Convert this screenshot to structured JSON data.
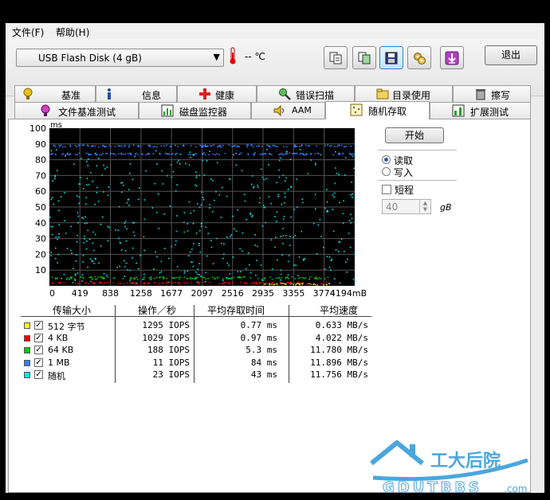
{
  "menu": {
    "file": "文件(F)",
    "help": "帮助(H)"
  },
  "toolbar": {
    "drive": "USB Flash Disk   (4 gB)",
    "temperature": "-- ℃",
    "exit": "退出",
    "icons": [
      "copy-icon",
      "copy-settings-icon",
      "save-icon",
      "options-icon",
      "download-icon"
    ]
  },
  "tabs_row1": [
    "基准",
    "信息",
    "健康",
    "错误扫描",
    "目录使用",
    "擦写"
  ],
  "tabs_row2": [
    "文件基准测试",
    "磁盘监控器",
    "AAM",
    "随机存取",
    "扩展测试"
  ],
  "active_tab": "随机存取",
  "controls": {
    "start": "开始",
    "read": "读取",
    "write": "写入",
    "short_run": "短程",
    "size_value": "40",
    "size_unit": "gB",
    "read_selected": true
  },
  "chart_data": {
    "type": "scatter",
    "yunit": "ms",
    "xunit": "mB",
    "ylim": [
      0,
      100
    ],
    "xlim": [
      0,
      4194
    ],
    "yticks": [
      "100",
      "90",
      "80",
      "70",
      "60",
      "50",
      "40",
      "30",
      "20",
      "10"
    ],
    "xticks": [
      "0",
      "419",
      "838",
      "1258",
      "1677",
      "2097",
      "2516",
      "2935",
      "3355",
      "3774",
      "4194mB"
    ],
    "grid": true,
    "series": [
      {
        "name": "512 字节",
        "color": "#ffff00",
        "level_ms": 0.77
      },
      {
        "name": "4 KB",
        "color": "#ff0000",
        "level_ms": 0.97
      },
      {
        "name": "64 KB",
        "color": "#00cc00",
        "level_ms": 5.3
      },
      {
        "name": "1 MB",
        "color": "#3a7bff",
        "level_ms": 84
      },
      {
        "name": "随机",
        "color": "#00e5e5",
        "level_ms": 43
      }
    ]
  },
  "results": {
    "headers": [
      "传输大小",
      "操作／秒",
      "平均存取时间",
      "平均速度"
    ],
    "rows": [
      {
        "color": "#ffff00",
        "name": "512 字节",
        "ops": "1295 IOPS",
        "time": "0.77 ms",
        "speed": "0.633 MB/s"
      },
      {
        "color": "#ff0000",
        "name": "4 KB",
        "ops": "1029 IOPS",
        "time": "0.97 ms",
        "speed": "4.022 MB/s"
      },
      {
        "color": "#00cc00",
        "name": "64 KB",
        "ops": "188 IOPS",
        "time": "5.3 ms",
        "speed": "11.780 MB/s"
      },
      {
        "color": "#3a7bff",
        "name": "1 MB",
        "ops": "11 IOPS",
        "time": "84 ms",
        "speed": "11.896 MB/s"
      },
      {
        "color": "#00e5e5",
        "name": "随机",
        "ops": "23 IOPS",
        "time": "43 ms",
        "speed": "11.756 MB/s"
      }
    ]
  },
  "watermark": {
    "cn": "工大后院",
    "en": "GDUTBBS",
    "suffix": ".com"
  }
}
